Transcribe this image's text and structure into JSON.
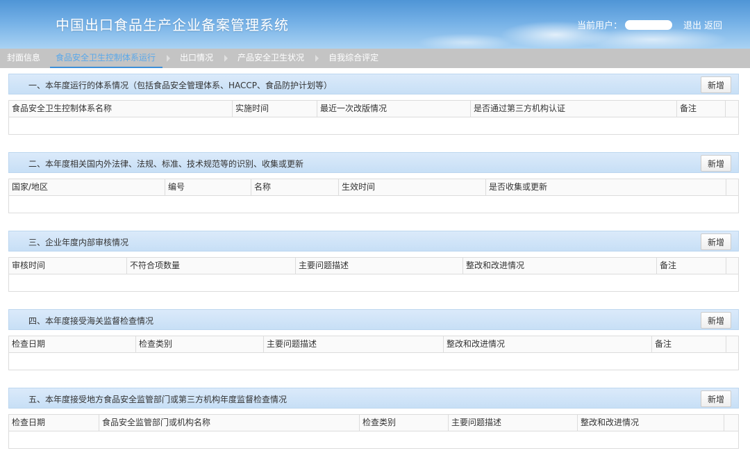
{
  "header": {
    "title": "中国出口食品生产企业备案管理系统",
    "user_label": "当前用户：",
    "logout": "退出",
    "back": "返回"
  },
  "tabs": [
    {
      "label": "封面信息",
      "active": false
    },
    {
      "label": "食品安全卫生控制体系运行",
      "active": true
    },
    {
      "label": "出口情况",
      "active": false
    },
    {
      "label": "产品安全卫生状况",
      "active": false
    },
    {
      "label": "自我综合评定",
      "active": false
    }
  ],
  "add_label": "新增",
  "sections": [
    {
      "title": "一、本年度运行的体系情况（包括食品安全管理体系、HACCP、食品防护计划等）",
      "columns": [
        "食品安全卫生控制体系名称",
        "实施时间",
        "最近一次改版情况",
        "是否通过第三方机构认证",
        "备注",
        ""
      ]
    },
    {
      "title": "二、本年度相关国内外法律、法规、标准、技术规范等的识别、收集或更新",
      "columns": [
        "国家/地区",
        "编号",
        "名称",
        "生效时间",
        "是否收集或更新",
        ""
      ]
    },
    {
      "title": "三、企业年度内部审核情况",
      "columns": [
        "审核时间",
        "不符合项数量",
        "主要问题描述",
        "整改和改进情况",
        "备注",
        ""
      ]
    },
    {
      "title": "四、本年度接受海关监督检查情况",
      "columns": [
        "检查日期",
        "检查类别",
        "主要问题描述",
        "整改和改进情况",
        "备注",
        ""
      ]
    },
    {
      "title": "五、本年度接受地方食品安全监管部门或第三方机构年度监督检查情况",
      "columns": [
        "检查日期",
        "食品安全监管部门或机构名称",
        "检查类别",
        "主要问题描述",
        "整改和改进情况",
        ""
      ]
    }
  ]
}
